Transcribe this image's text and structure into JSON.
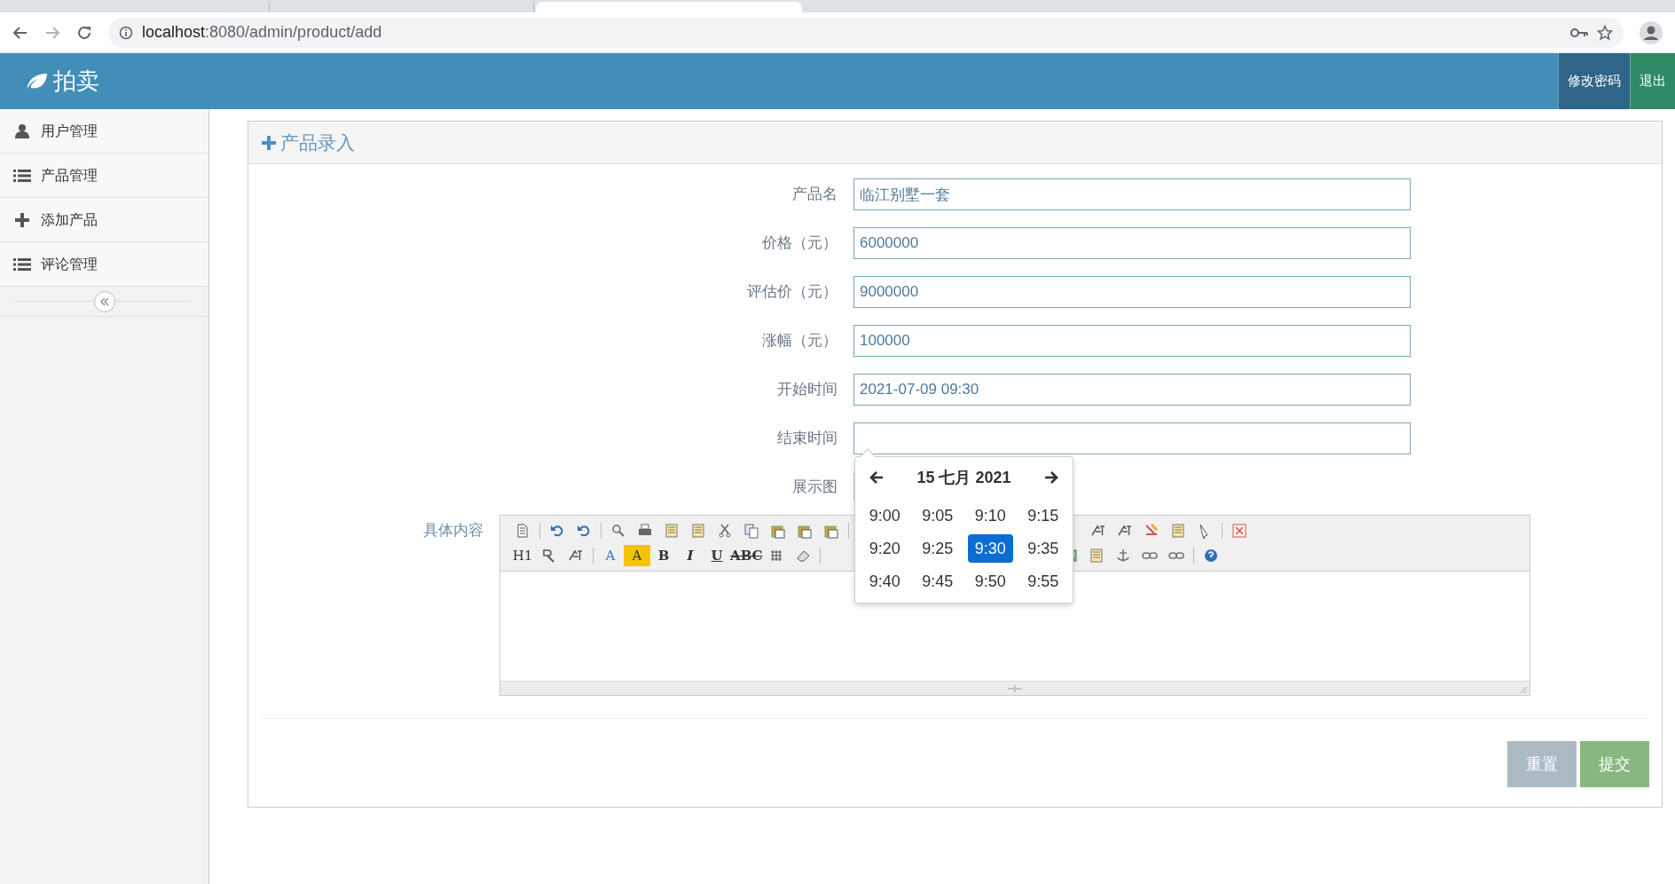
{
  "browser": {
    "url_host": "localhost",
    "url_rest": ":8080/admin/product/add"
  },
  "header": {
    "brand": "拍卖",
    "buttons": [
      {
        "kind": "dark",
        "label": "修改密码"
      },
      {
        "kind": "green",
        "label": "退出"
      }
    ]
  },
  "sidebar": {
    "items": [
      {
        "label": "用户管理"
      },
      {
        "label": "产品管理"
      },
      {
        "label": "添加产品"
      },
      {
        "label": "评论管理"
      }
    ]
  },
  "panel": {
    "title": "产品录入"
  },
  "fields": [
    {
      "label": "产品名",
      "value": "临江别墅一套"
    },
    {
      "label": "价格（元）",
      "value": "6000000"
    },
    {
      "label": "评估价（元）",
      "value": "9000000"
    },
    {
      "label": "涨幅（元）",
      "value": "100000"
    },
    {
      "label": "开始时间",
      "value": "2021-07-09 09:30"
    },
    {
      "label": "结束时间",
      "kind": "text"
    },
    {
      "label": "展示图",
      "kind": "file"
    }
  ],
  "editor": {
    "label": "具体内容",
    "toolbar": [
      [
        {
          "kind": "icon"
        },
        {
          "kind": "sep"
        },
        {
          "kind": "icon"
        },
        {
          "kind": "icon"
        },
        {
          "kind": "sep"
        },
        {
          "kind": "icon"
        },
        {
          "kind": "icon"
        },
        {
          "kind": "icon"
        },
        {
          "kind": "icon"
        },
        {
          "kind": "icon"
        },
        {
          "kind": "icon"
        },
        {
          "kind": "icon"
        },
        {
          "kind": "icon"
        },
        {
          "kind": "icon"
        },
        {
          "kind": "sep"
        },
        {
          "kind": "gap"
        },
        {
          "kind": "icon"
        },
        {
          "kind": "icon"
        },
        {
          "kind": "icon"
        },
        {
          "kind": "icon"
        },
        {
          "kind": "icon"
        },
        {
          "kind": "sep"
        },
        {
          "kind": "icon"
        }
      ],
      [
        {
          "kind": "text",
          "label": "H1"
        },
        {
          "kind": "icon"
        },
        {
          "kind": "icon"
        },
        {
          "kind": "sep"
        },
        {
          "kind": "text",
          "label": "A"
        },
        {
          "kind": "text",
          "label": "A"
        },
        {
          "kind": "text",
          "label": "B"
        },
        {
          "kind": "text",
          "label": "I"
        },
        {
          "kind": "text",
          "label": "U"
        },
        {
          "kind": "text",
          "label": "ABC"
        },
        {
          "kind": "icon"
        },
        {
          "kind": "icon"
        },
        {
          "kind": "sep"
        },
        {
          "kind": "gap"
        },
        {
          "kind": "icon"
        },
        {
          "kind": "icon"
        },
        {
          "kind": "icon"
        },
        {
          "kind": "icon"
        },
        {
          "kind": "icon"
        },
        {
          "kind": "sep"
        },
        {
          "kind": "icon"
        }
      ]
    ]
  },
  "datepicker": {
    "title": "15 七月 2021",
    "times": [
      {
        "label": "9:00",
        "selected": false
      },
      {
        "label": "9:05",
        "selected": false
      },
      {
        "label": "9:10",
        "selected": false
      },
      {
        "label": "9:15",
        "selected": false
      },
      {
        "label": "9:20",
        "selected": false
      },
      {
        "label": "9:25",
        "selected": false
      },
      {
        "label": "9:30",
        "selected": true
      },
      {
        "label": "9:35",
        "selected": false
      },
      {
        "label": "9:40",
        "selected": false
      },
      {
        "label": "9:45",
        "selected": false
      },
      {
        "label": "9:50",
        "selected": false
      },
      {
        "label": "9:55",
        "selected": false
      }
    ]
  },
  "actions": [
    {
      "kind": "reset",
      "label": "重置"
    },
    {
      "kind": "submit",
      "label": "提交"
    }
  ]
}
